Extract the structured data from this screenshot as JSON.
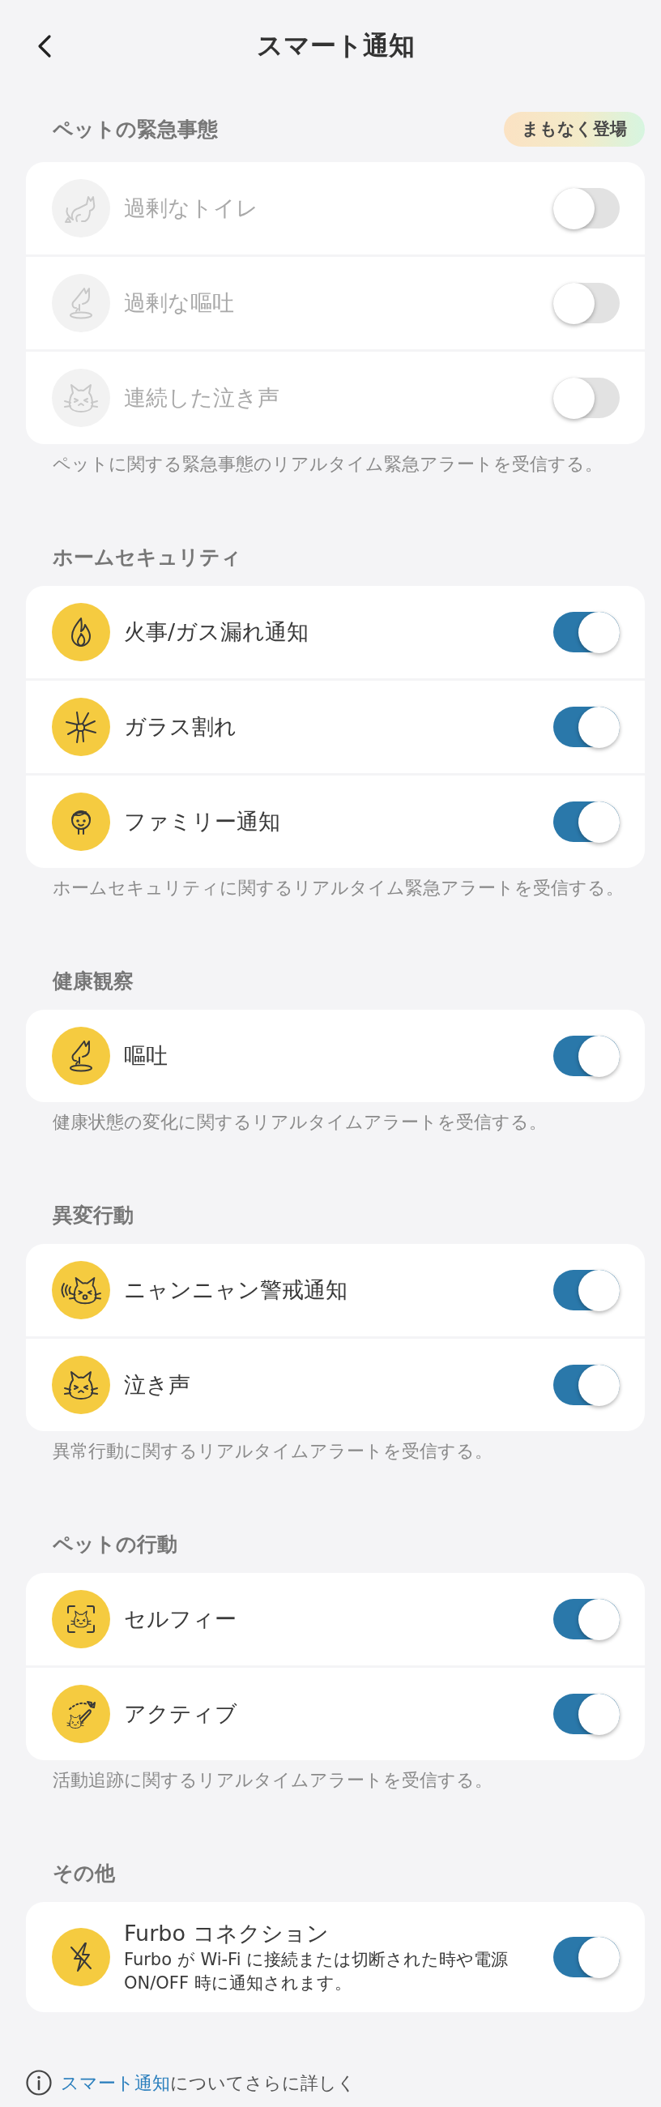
{
  "header": {
    "title": "スマート通知"
  },
  "sections": [
    {
      "title": "ペットの緊急事態",
      "badge": "まもなく登場",
      "items": [
        {
          "label": "過剰なトイレ",
          "disabled": true,
          "on": false
        },
        {
          "label": "過剰な嘔吐",
          "disabled": true,
          "on": false
        },
        {
          "label": "連続した泣き声",
          "disabled": true,
          "on": false
        }
      ],
      "description": "ペットに関する緊急事態のリアルタイム緊急アラートを受信する。"
    },
    {
      "title": "ホームセキュリティ",
      "items": [
        {
          "label": "火事/ガス漏れ通知",
          "disabled": false,
          "on": true
        },
        {
          "label": "ガラス割れ",
          "disabled": false,
          "on": true
        },
        {
          "label": "ファミリー通知",
          "disabled": false,
          "on": true
        }
      ],
      "description": "ホームセキュリティに関するリアルタイム緊急アラートを受信する。"
    },
    {
      "title": "健康観察",
      "items": [
        {
          "label": "嘔吐",
          "disabled": false,
          "on": true
        }
      ],
      "description": "健康状態の変化に関するリアルタイムアラートを受信する。"
    },
    {
      "title": "異変行動",
      "items": [
        {
          "label": "ニャンニャン警戒通知",
          "disabled": false,
          "on": true
        },
        {
          "label": "泣き声",
          "disabled": false,
          "on": true
        }
      ],
      "description": "異常行動に関するリアルタイムアラートを受信する。"
    },
    {
      "title": "ペットの行動",
      "items": [
        {
          "label": "セルフィー",
          "disabled": false,
          "on": true
        },
        {
          "label": "アクティブ",
          "disabled": false,
          "on": true
        }
      ],
      "description": "活動追跡に関するリアルタイムアラートを受信する。"
    },
    {
      "title": "その他",
      "items": [
        {
          "label": "Furbo コネクション",
          "description": "Furbo が Wi-Fi に接続または切断された時や電源 ON/OFF 時に通知されます。",
          "disabled": false,
          "on": true
        }
      ]
    }
  ],
  "footer": {
    "link": "スマート通知",
    "text": "についてさらに詳しく"
  }
}
